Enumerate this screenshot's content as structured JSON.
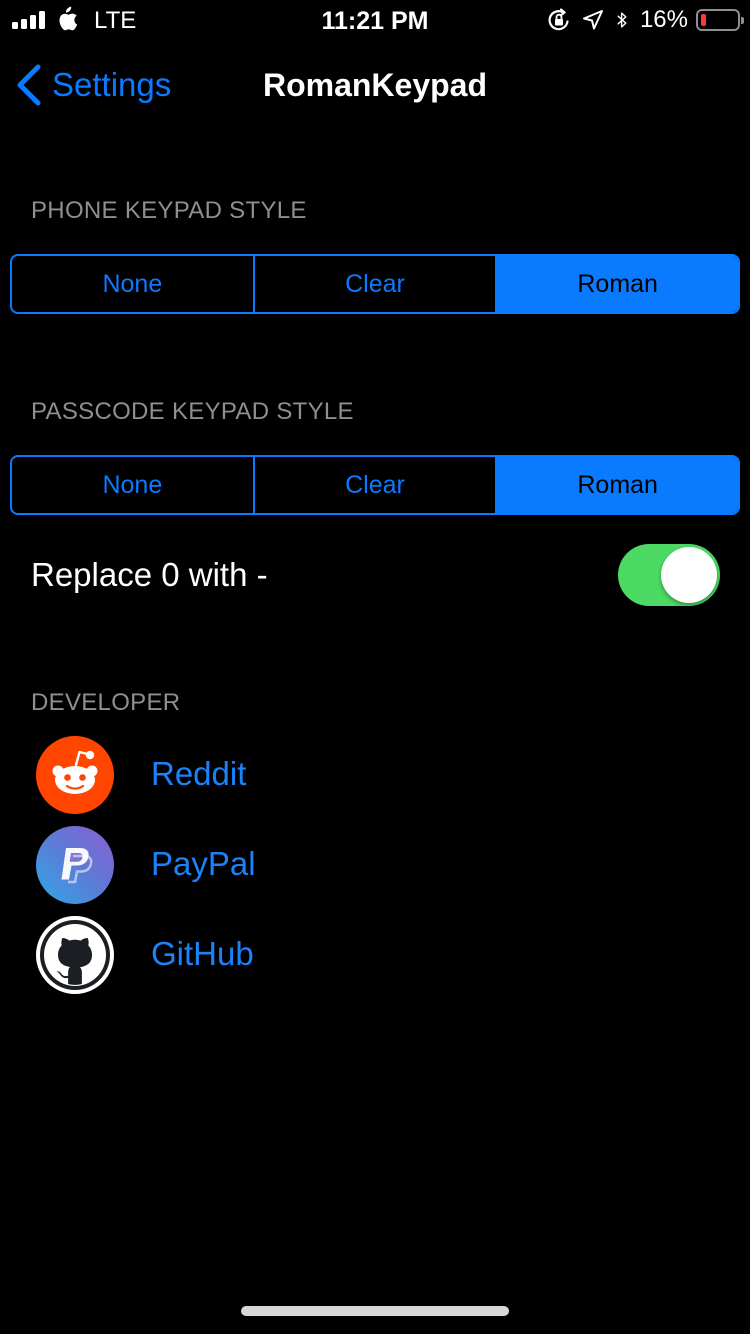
{
  "theme": {
    "accent": "#0a7afe",
    "link": "#1a82fb",
    "switch_on": "#4cd964",
    "header_text": "#8e8e93",
    "battery_low": "#ff3b30"
  },
  "status_bar": {
    "carrier": "LTE",
    "time": "11:21 PM",
    "battery_percent": "16%",
    "battery_level": 0.16,
    "signal_bars": 4,
    "signal_bars_active": 3,
    "icons": [
      "apple-icon",
      "orientation-lock-icon",
      "location-arrow-icon",
      "bluetooth-icon",
      "battery-icon"
    ]
  },
  "nav": {
    "back_label": "Settings",
    "title": "RomanKeypad"
  },
  "phone_keypad": {
    "header": "PHONE KEYPAD STYLE",
    "options": [
      "None",
      "Clear",
      "Roman"
    ],
    "selected": "Roman"
  },
  "passcode_keypad": {
    "header": "PASSCODE KEYPAD STYLE",
    "options": [
      "None",
      "Clear",
      "Roman"
    ],
    "selected": "Roman"
  },
  "replace_zero": {
    "label": "Replace 0 with -",
    "on": true
  },
  "developer": {
    "header": "DEVELOPER",
    "links": [
      {
        "label": "Reddit",
        "icon": "reddit-icon"
      },
      {
        "label": "PayPal",
        "icon": "paypal-icon"
      },
      {
        "label": "GitHub",
        "icon": "github-icon"
      }
    ]
  }
}
